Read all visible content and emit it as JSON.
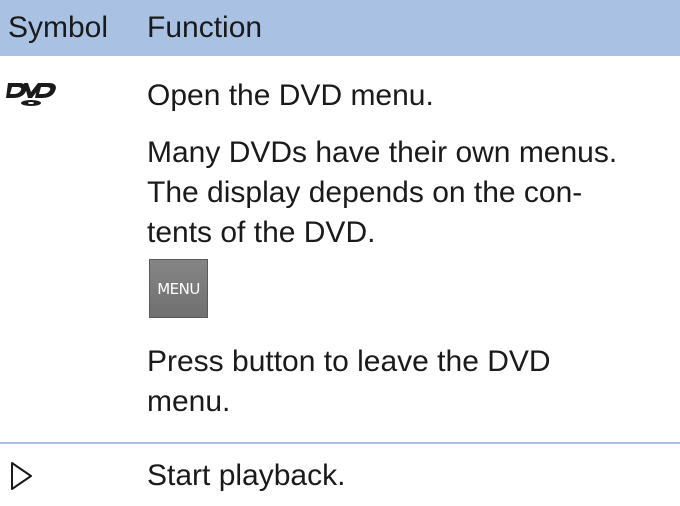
{
  "header": {
    "symbol": "Symbol",
    "function": "Function"
  },
  "rows": [
    {
      "icon": "dvd-logo-icon",
      "lines": [
        "Open the DVD menu.",
        "Many DVDs have their own menus.",
        "The display depends on the con-",
        "tents of the DVD."
      ],
      "button": {
        "label": "MENU",
        "icon": "menu-button-icon"
      },
      "after": [
        "Press button to leave the DVD",
        "menu."
      ]
    },
    {
      "icon": "play-triangle-icon",
      "lines": [
        "Start playback."
      ]
    }
  ],
  "colors": {
    "header_bg": "#a9c2e3",
    "text": "#1a1a1a",
    "button_bg": "#7a7a7a"
  }
}
